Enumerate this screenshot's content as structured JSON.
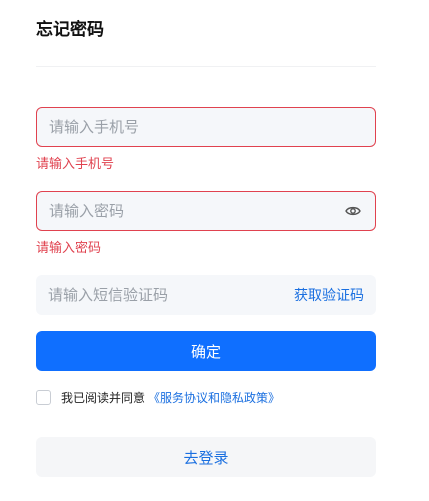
{
  "page": {
    "title": "忘记密码"
  },
  "form": {
    "phone": {
      "value": "",
      "placeholder": "请输入手机号",
      "error": "请输入手机号"
    },
    "password": {
      "value": "",
      "placeholder": "请输入密码",
      "error": "请输入密码"
    },
    "sms_code": {
      "value": "",
      "placeholder": "请输入短信验证码",
      "get_code_label": "获取验证码"
    },
    "confirm_label": "确定",
    "agreement": {
      "checked": false,
      "text": "我已阅读并同意",
      "link": "《服务协议和隐私政策》"
    },
    "login_label": "去登录"
  },
  "colors": {
    "primary": "#0f6fff",
    "link": "#1a6fe0",
    "error": "#e0424f",
    "field_bg": "#f5f7fa"
  },
  "icons": {
    "password_toggle": "eye-icon"
  }
}
